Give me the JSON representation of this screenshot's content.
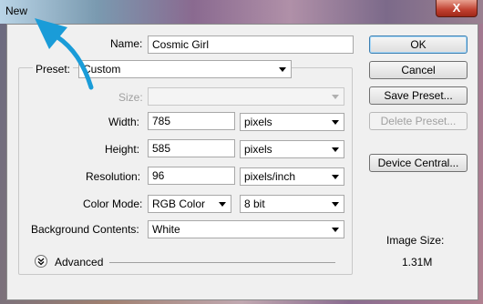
{
  "window": {
    "title": "New",
    "close": "X"
  },
  "form": {
    "name_label": "Name:",
    "name_value": "Cosmic Girl",
    "preset_label": "Preset:",
    "preset_value": "Custom",
    "size_label": "Size:",
    "size_value": "",
    "width_label": "Width:",
    "width_value": "785",
    "width_unit": "pixels",
    "height_label": "Height:",
    "height_value": "585",
    "height_unit": "pixels",
    "resolution_label": "Resolution:",
    "resolution_value": "96",
    "resolution_unit": "pixels/inch",
    "color_mode_label": "Color Mode:",
    "color_mode_value": "RGB Color",
    "bit_depth_value": "8 bit",
    "background_label": "Background Contents:",
    "background_value": "White",
    "advanced_label": "Advanced"
  },
  "buttons": {
    "ok": "OK",
    "cancel": "Cancel",
    "save_preset": "Save Preset...",
    "delete_preset": "Delete Preset...",
    "device_central": "Device Central..."
  },
  "info": {
    "image_size_label": "Image Size:",
    "image_size_value": "1.31M"
  },
  "colors": {
    "arrow": "#1a9cd8",
    "default_button_border": "#3c7fb1",
    "close_button": "#c04030"
  }
}
